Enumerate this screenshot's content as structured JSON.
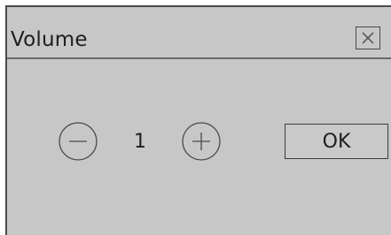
{
  "dialog": {
    "title": "Volume",
    "close_icon": "close-icon",
    "volume_value": "1",
    "decrease_icon": "minus-circle-icon",
    "increase_icon": "plus-circle-icon",
    "ok_label": "OK"
  },
  "colors": {
    "background": "#c7c7c8",
    "border": "#4a4a4a",
    "text": "#1e1e1e",
    "divider": "#6b6b6b"
  }
}
